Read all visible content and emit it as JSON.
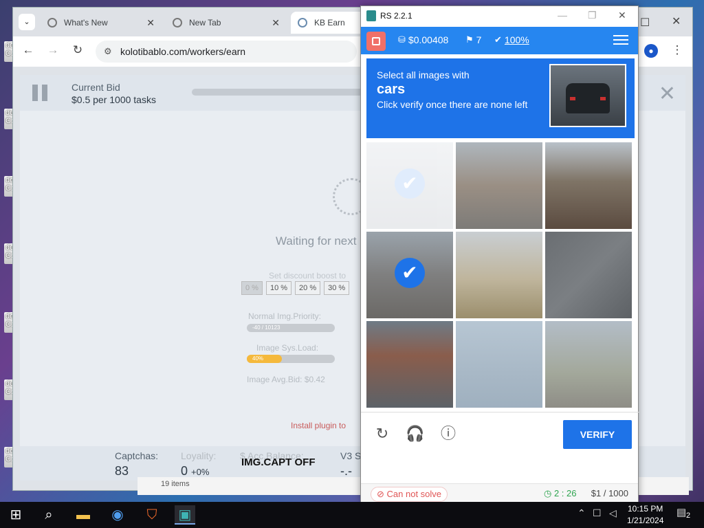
{
  "desktop": {
    "icons": [
      {
        "label_top": "do",
        "label_bottom": "C:"
      },
      {
        "label_top": "do",
        "label_bottom": "C:"
      },
      {
        "label_top": "do",
        "label_bottom": "C:"
      },
      {
        "label_top": "do",
        "label_bottom": "C:"
      },
      {
        "label_top": "do",
        "label_bottom": "C:"
      },
      {
        "label_top": "do",
        "label_bottom": "C:"
      },
      {
        "label_top": "do",
        "label_bottom": "C:"
      }
    ]
  },
  "browser": {
    "tabs": [
      {
        "label": "What's New",
        "close": "✕"
      },
      {
        "label": "New Tab",
        "close": "✕"
      },
      {
        "label": "KB Earn"
      }
    ],
    "tab_search": "⌄",
    "url": "kolotibablo.com/workers/earn",
    "status_bar": "19 items"
  },
  "page": {
    "current_bid_label": "Current Bid",
    "current_bid_value": "$0.5 per 1000 tasks",
    "waiting_text": "Waiting for next",
    "discount_label": "Set discount boost to",
    "discount_options": [
      "0 %",
      "10 %",
      "20 %",
      "30 %"
    ],
    "normal_priority_label": "Normal Img.Priority:",
    "normal_priority_value": "-40 / 10123",
    "sys_load_label": "Image Sys.Load:",
    "sys_load_value": "40%",
    "sys_load_level": 0.4,
    "avg_bid_label": "Image Avg.Bid: $0.42",
    "install_plugin": "Install plugin to",
    "footer": {
      "captchas_label": "Captchas:",
      "captchas_value": "83",
      "loyalty_label": "Loyality:",
      "loyalty_value": "0",
      "loyalty_change": "+0%",
      "balance_label": "$ Acc.Balance:",
      "imgcapt": "IMG.CAPT OFF",
      "v3_label": "V3 S",
      "v3_value": "-.-"
    }
  },
  "rs": {
    "title": "RS 2.2.1",
    "balance": "$0.00408",
    "count": "7",
    "accuracy": "100%",
    "captcha": {
      "instruction_line1": "Select all images with",
      "target": "cars",
      "instruction_line2": "Click verify once there are none left",
      "verify_label": "VERIFY"
    },
    "status": {
      "cannot_solve": "Can not solve",
      "timer": "2 : 26",
      "rate": "$1 / 1000"
    }
  },
  "taskbar": {
    "time": "10:15 PM",
    "date": "1/21/2024",
    "notifications": "2"
  },
  "colors": {
    "accent": "#1e73e8",
    "rs_bar": "#2686f0",
    "stop": "#f07068",
    "cannot_solve": "#e05555",
    "timer": "#2ea44f"
  }
}
